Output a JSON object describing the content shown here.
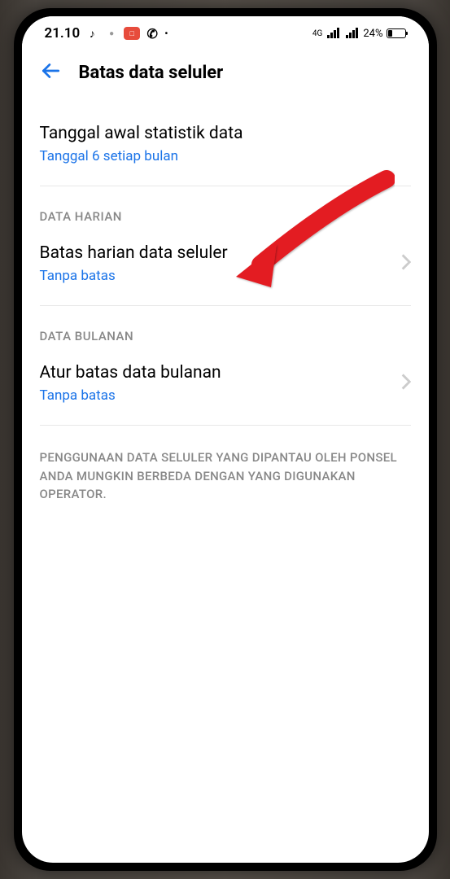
{
  "status_bar": {
    "time": "21.10",
    "signal_type": "4G",
    "battery_percent": "24%"
  },
  "header": {
    "title": "Batas data seluler"
  },
  "stats_start": {
    "title": "Tanggal awal statistik data",
    "subtitle": "Tanggal 6 setiap bulan"
  },
  "sections": {
    "daily": {
      "header": "DATA HARIAN",
      "item_title": "Batas harian data seluler",
      "item_subtitle": "Tanpa batas"
    },
    "monthly": {
      "header": "DATA BULANAN",
      "item_title": "Atur batas data bulanan",
      "item_subtitle": "Tanpa batas"
    }
  },
  "disclaimer": "PENGGUNAAN DATA SELULER YANG DIPANTAU OLEH PONSEL ANDA MUNGKIN BERBEDA DENGAN YANG DIGUNAKAN OPERATOR."
}
